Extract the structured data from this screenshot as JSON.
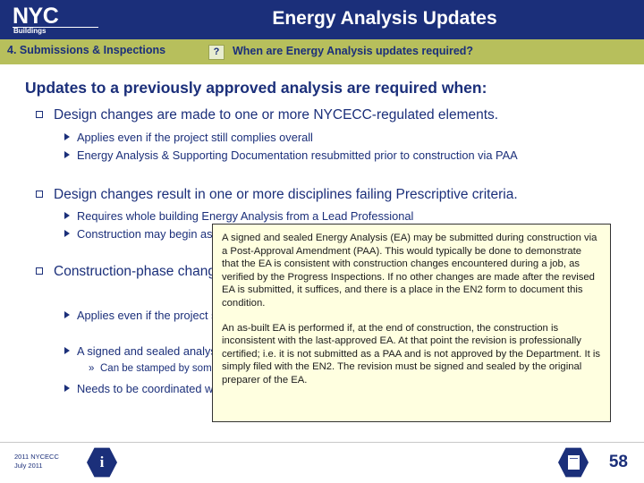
{
  "header": {
    "logo_main": "NYC",
    "logo_sub": "Buildings",
    "title": "Energy Analysis Updates",
    "accent_color": "#1b2f7a"
  },
  "subheader": {
    "section_label": "4. Submissions & Inspections",
    "badge": "?",
    "question": "When are Energy Analysis updates required?",
    "band_color": "#b7bf5c"
  },
  "body": {
    "title": "Updates to a previously approved analysis are required when:",
    "bullets": [
      {
        "text": "Design changes are made to one or more NYCECC-regulated elements.",
        "subs": [
          {
            "text": "Applies even if the project still complies overall"
          },
          {
            "text": "Energy Analysis & Supporting Documentation resubmitted prior to construction via PAA"
          }
        ]
      },
      {
        "text": "Design changes result in one or more disciplines failing Prescriptive criteria.",
        "subs": [
          {
            "text": "Requires whole building Energy Analysis from a Lead Professional"
          },
          {
            "text": "Construction may begin as soon as the DOB approves the revised Energy Analysis"
          }
        ]
      },
      {
        "text": "Construction-phase changes are made to one or more NYCECC-regulated elements.",
        "subs": [
          {
            "text": "Applies even if the project still complies overall (e.g. reduced lighting densities)",
            "subsubs": []
          },
          {
            "text": "A signed and sealed analysis must be submitted",
            "subsubs": [
              {
                "text": "Can be stamped by someone other than the Lead Professional"
              }
            ]
          },
          {
            "text": "Needs to be coordinated with the Progress Inspections",
            "subsubs": []
          }
        ]
      }
    ]
  },
  "callout": {
    "background_color": "#ffffe0",
    "paragraphs": [
      "A signed and sealed Energy Analysis (EA) may be submitted during construction via a Post-Approval Amendment (PAA). This would typically be done to demonstrate that the EA is consistent with construction changes encountered during a job, as verified by the Progress Inspections. If no other changes are made after the revised EA is submitted, it suffices, and there is a place in the EN2 form to document this condition.",
      "An as-built EA is performed if, at the end of construction, the construction is inconsistent with the last-approved EA. At that point the revision is professionally certified; i.e. it is not submitted as a PAA and is not approved by the Department.  It is simply filed with the EN2.  The revision must be signed and sealed by the original preparer of the EA."
    ]
  },
  "footer": {
    "line1": "2011 NYCECC",
    "line2": "July 2011",
    "info_icon": "info-icon",
    "doc_icon": "document-icon",
    "page_number": "58"
  }
}
